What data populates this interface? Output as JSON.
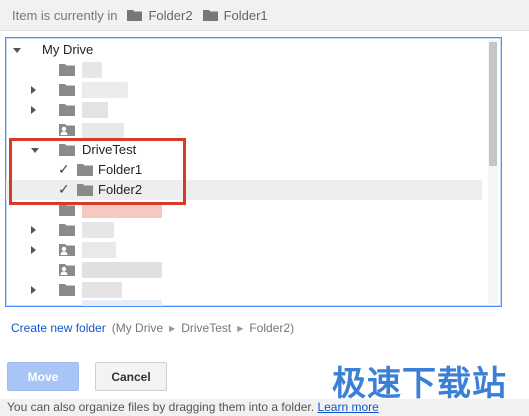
{
  "location": {
    "prefix": "Item is currently in",
    "folders": [
      "Folder2",
      "Folder1"
    ]
  },
  "tree": {
    "root_label": "My Drive",
    "drive_test_label": "DriveTest",
    "folder1_label": "Folder1",
    "folder2_label": "Folder2",
    "checkmark": "✓"
  },
  "create_folder": {
    "link_label": "Create new folder",
    "path_open": "(My Drive",
    "path_mid": "DriveTest",
    "path_end": "Folder2)"
  },
  "buttons": {
    "move_label": "Move",
    "cancel_label": "Cancel"
  },
  "footer": {
    "text": "You can also organize files by dragging them into a folder.",
    "link_label": "Learn more"
  },
  "watermark": "极速下载站",
  "colors": {
    "accent_link": "#1155cc",
    "focus_border": "#4d90fe",
    "highlight": "#d43b2b",
    "move_button": "#a8c5f5"
  }
}
